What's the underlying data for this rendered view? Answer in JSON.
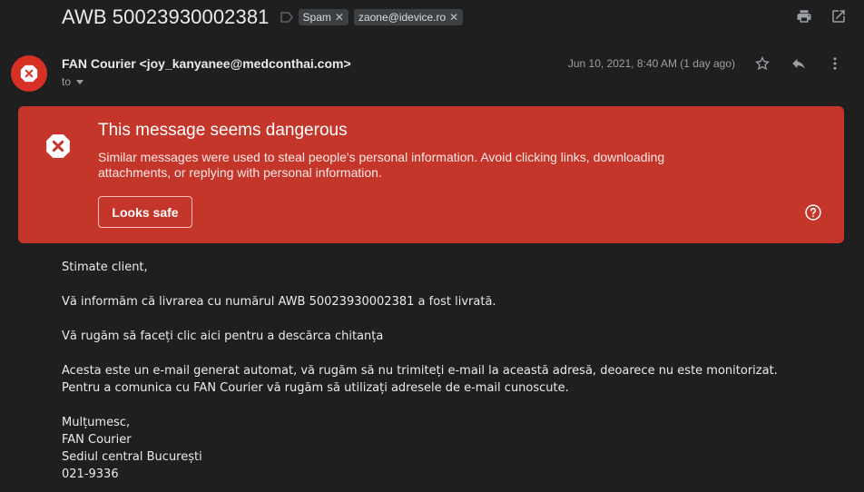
{
  "email": {
    "subject": "AWB 50023930002381",
    "labels": [
      {
        "text": "Spam"
      },
      {
        "text": "zaone@idevice.ro"
      }
    ],
    "sender": "FAN Courier <joy_kanyanee@medconthai.com>",
    "to_label": "to",
    "date": "Jun 10, 2021, 8:40 AM (1 day ago)"
  },
  "warning": {
    "title": "This message seems dangerous",
    "text": "Similar messages were used to steal people's personal information. Avoid clicking links, downloading attachments, or replying with personal information.",
    "button": "Looks safe"
  },
  "body": {
    "greeting": "Stimate client,",
    "line1": "Vă informăm că livrarea cu numărul AWB 50023930002381 a fost livrată.",
    "line2": "Vă rugăm să faceți clic aici pentru a descărca chitanța",
    "line3a": "Acesta este un e-mail generat automat, vă rugăm să nu trimiteți e-mail la această adresă, deoarece nu este monitorizat.",
    "line3b": "Pentru a comunica cu FAN Courier vă rugăm să utilizați adresele de e-mail cunoscute.",
    "sig1": "Mulțumesc,",
    "sig2": "FAN Courier",
    "sig3": "Sediul central București",
    "sig4": "021-9336"
  },
  "colors": {
    "background": "#1f1f1f",
    "danger": "#c5362a",
    "avatar": "#d93025"
  },
  "icons": [
    "label-icon",
    "close-icon",
    "print-icon",
    "open-in-new-icon",
    "danger-icon",
    "star-icon",
    "reply-icon",
    "more-vert-icon",
    "chevron-down-icon",
    "help-icon"
  ]
}
